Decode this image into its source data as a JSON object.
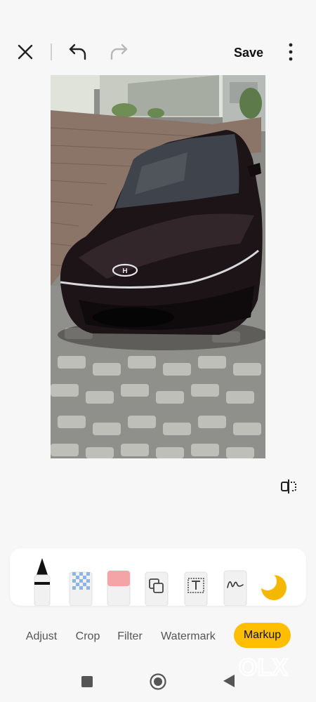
{
  "toolbar": {
    "save_label": "Save",
    "icons": [
      "close-icon",
      "undo-icon",
      "redo-icon",
      "more-vertical-icon"
    ]
  },
  "photo": {
    "subject": "car-photo",
    "badge_text": "H"
  },
  "tools": [
    "pen",
    "mosaic",
    "eraser",
    "shape",
    "text",
    "signature",
    "color"
  ],
  "tabs": {
    "adjust": "Adjust",
    "crop": "Crop",
    "filter": "Filter",
    "watermark": "Watermark",
    "markup": "Markup",
    "active": "Markup"
  },
  "navbar": [
    "recents-square-icon",
    "home-circle-icon",
    "back-triangle-icon"
  ],
  "overlay": {
    "logo_text": "OLX"
  },
  "colors": {
    "accent": "#ffbf00",
    "background": "#f7f7f7",
    "redo_disabled": "#b8b8b8"
  }
}
